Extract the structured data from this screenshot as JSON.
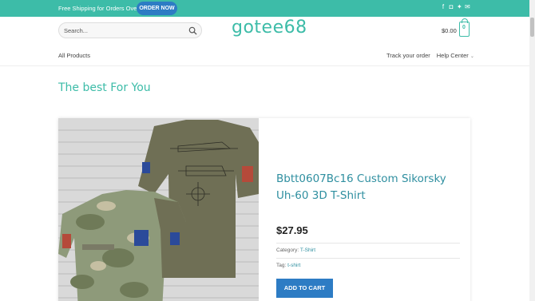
{
  "topbar": {
    "promo": "Free Shipping for Orders Over $99",
    "order_button": "ORDER NOW",
    "social_icons": [
      "facebook-icon",
      "instagram-icon",
      "twitter-icon",
      "email-icon"
    ]
  },
  "header": {
    "search_placeholder": "Search...",
    "logo": "gotee68",
    "cart_total": "$0.00",
    "cart_count": "0"
  },
  "nav": {
    "left": "All Products",
    "track": "Track your order",
    "help": "Help Center"
  },
  "section_title": "The best For You",
  "product": {
    "title": "Bbtt0607Bc16 Custom Sikorsky Uh-60 3D T-Shirt",
    "price": "$27.95",
    "category_label": "Category:",
    "category": "T-Shirt",
    "tag_label": "Tag:",
    "tag": "t-shirt",
    "add_to_cart": "ADD TO CART"
  },
  "colors": {
    "accent": "#3dbca8",
    "button": "#2d7cc4",
    "title": "#2f8fa0"
  }
}
